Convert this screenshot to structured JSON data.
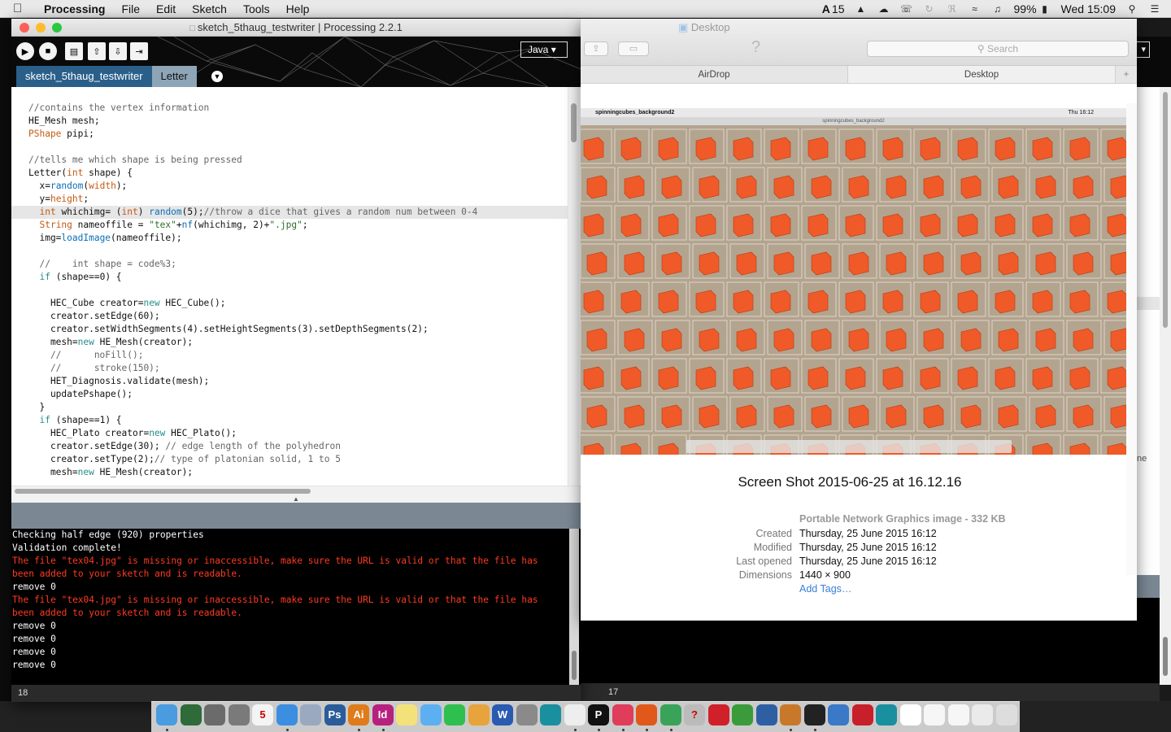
{
  "menubar": {
    "app": "Processing",
    "items": [
      "File",
      "Edit",
      "Sketch",
      "Tools",
      "Help"
    ],
    "status_badge": "15",
    "battery": "99%",
    "clock": "Wed 15:09"
  },
  "processing": {
    "window_title": "sketch_5thaug_testwriter | Processing 2.2.1",
    "mode": "Java",
    "tabs": [
      "sketch_5thaug_testwriter",
      "Letter"
    ],
    "active_tab": 0,
    "code_lines": [
      {
        "segments": [
          {
            "t": "//contains the vertex information",
            "c": "cm"
          }
        ]
      },
      {
        "segments": [
          {
            "t": "HE_Mesh mesh;",
            "c": ""
          }
        ]
      },
      {
        "segments": [
          {
            "t": "PShape",
            "c": "ty"
          },
          {
            "t": " pipi;",
            "c": ""
          }
        ]
      },
      {
        "segments": [
          {
            "t": "",
            "c": ""
          }
        ]
      },
      {
        "segments": [
          {
            "t": "//tells me which shape is being pressed",
            "c": "cm"
          }
        ]
      },
      {
        "segments": [
          {
            "t": "Letter(",
            "c": ""
          },
          {
            "t": "int",
            "c": "ty"
          },
          {
            "t": " shape) {",
            "c": ""
          }
        ]
      },
      {
        "segments": [
          {
            "t": "  x=",
            "c": ""
          },
          {
            "t": "random",
            "c": "fn"
          },
          {
            "t": "(",
            "c": ""
          },
          {
            "t": "width",
            "c": "ty"
          },
          {
            "t": ");",
            "c": ""
          }
        ]
      },
      {
        "segments": [
          {
            "t": "  y=",
            "c": ""
          },
          {
            "t": "height",
            "c": "ty"
          },
          {
            "t": ";",
            "c": ""
          }
        ]
      },
      {
        "segments": [
          {
            "t": "  ",
            "c": ""
          },
          {
            "t": "int",
            "c": "ty"
          },
          {
            "t": " whichimg= (",
            "c": ""
          },
          {
            "t": "int",
            "c": "ty"
          },
          {
            "t": ") ",
            "c": ""
          },
          {
            "t": "random",
            "c": "fn"
          },
          {
            "t": "(5);",
            "c": ""
          },
          {
            "t": "//throw a dice that gives a random num between 0-4",
            "c": "cm"
          }
        ],
        "highlight": true
      },
      {
        "segments": [
          {
            "t": "  ",
            "c": ""
          },
          {
            "t": "String",
            "c": "ty"
          },
          {
            "t": " nameoffile = ",
            "c": ""
          },
          {
            "t": "\"tex\"",
            "c": "str"
          },
          {
            "t": "+",
            "c": ""
          },
          {
            "t": "nf",
            "c": "fn"
          },
          {
            "t": "(whichimg, 2)+",
            "c": ""
          },
          {
            "t": "\".jpg\"",
            "c": "str"
          },
          {
            "t": ";",
            "c": ""
          }
        ]
      },
      {
        "segments": [
          {
            "t": "  img=",
            "c": ""
          },
          {
            "t": "loadImage",
            "c": "fn"
          },
          {
            "t": "(nameoffile);",
            "c": ""
          }
        ]
      },
      {
        "segments": [
          {
            "t": "",
            "c": ""
          }
        ]
      },
      {
        "segments": [
          {
            "t": "  //    int shape = code%3;",
            "c": "cm"
          }
        ]
      },
      {
        "segments": [
          {
            "t": "  ",
            "c": ""
          },
          {
            "t": "if",
            "c": "kw"
          },
          {
            "t": " (shape==0) {",
            "c": ""
          }
        ]
      },
      {
        "segments": [
          {
            "t": "",
            "c": ""
          }
        ]
      },
      {
        "segments": [
          {
            "t": "    HEC_Cube creator=",
            "c": ""
          },
          {
            "t": "new",
            "c": "kw"
          },
          {
            "t": " HEC_Cube();",
            "c": ""
          }
        ]
      },
      {
        "segments": [
          {
            "t": "    creator.setEdge(60);",
            "c": ""
          }
        ]
      },
      {
        "segments": [
          {
            "t": "    creator.setWidthSegments(4).setHeightSegments(3).setDepthSegments(2);",
            "c": ""
          }
        ]
      },
      {
        "segments": [
          {
            "t": "    mesh=",
            "c": ""
          },
          {
            "t": "new",
            "c": "kw"
          },
          {
            "t": " HE_Mesh(creator);",
            "c": ""
          }
        ]
      },
      {
        "segments": [
          {
            "t": "    //      noFill();",
            "c": "cm"
          }
        ]
      },
      {
        "segments": [
          {
            "t": "    //      stroke(150);",
            "c": "cm"
          }
        ]
      },
      {
        "segments": [
          {
            "t": "    HET_Diagnosis.validate(mesh);",
            "c": ""
          }
        ]
      },
      {
        "segments": [
          {
            "t": "    updatePshape();",
            "c": ""
          }
        ]
      },
      {
        "segments": [
          {
            "t": "  }",
            "c": ""
          }
        ]
      },
      {
        "segments": [
          {
            "t": "  ",
            "c": ""
          },
          {
            "t": "if",
            "c": "kw"
          },
          {
            "t": " (shape==1) {",
            "c": ""
          }
        ]
      },
      {
        "segments": [
          {
            "t": "    HEC_Plato creator=",
            "c": ""
          },
          {
            "t": "new",
            "c": "kw"
          },
          {
            "t": " HEC_Plato();",
            "c": ""
          }
        ]
      },
      {
        "segments": [
          {
            "t": "    creator.setEdge(30); ",
            "c": ""
          },
          {
            "t": "// edge length of the polyhedron",
            "c": "cm"
          }
        ]
      },
      {
        "segments": [
          {
            "t": "    creator.setType(2);",
            "c": ""
          },
          {
            "t": "// type of platonian solid, 1 to 5",
            "c": "cm"
          }
        ]
      },
      {
        "segments": [
          {
            "t": "    mesh=",
            "c": ""
          },
          {
            "t": "new",
            "c": "kw"
          },
          {
            "t": " HE_Mesh(creator);",
            "c": ""
          }
        ]
      }
    ],
    "console": [
      {
        "text": "Checking half edge (920) properties",
        "err": false
      },
      {
        "text": "Validation complete!",
        "err": false
      },
      {
        "text": "The file \"tex04.jpg\" is missing or inaccessible, make sure the URL is valid or that the file has",
        "err": true
      },
      {
        "text": "been added to your sketch and is readable.",
        "err": true
      },
      {
        "text": "remove 0",
        "err": false
      },
      {
        "text": "The file \"tex04.jpg\" is missing or inaccessible, make sure the URL is valid or that the file has",
        "err": true
      },
      {
        "text": "been added to your sketch and is readable.",
        "err": true
      },
      {
        "text": "remove 0",
        "err": false
      },
      {
        "text": "remove 0",
        "err": false
      },
      {
        "text": "remove 0",
        "err": false
      },
      {
        "text": "remove 0",
        "err": false
      }
    ],
    "line_number": "18",
    "second_window_line_number": "17"
  },
  "finder": {
    "title": "Desktop",
    "search_placeholder": "Search",
    "tabs": [
      "AirDrop",
      "Desktop"
    ],
    "preview_app_name": "spinningcubes_background2",
    "preview_window_title": "spinningcubes_background2",
    "preview_clock": "Thu 16:12",
    "file_name": "Screen Shot 2015-06-25 at 16.12.16",
    "kind": "Portable Network Graphics image - 332 KB",
    "info": [
      {
        "label": "Created",
        "value": "Thursday, 25 June 2015 16:12"
      },
      {
        "label": "Modified",
        "value": "Thursday, 25 June 2015 16:12"
      },
      {
        "label": "Last opened",
        "value": "Thursday, 25 June 2015 16:12"
      },
      {
        "label": "Dimensions",
        "value": "1440 × 900"
      }
    ],
    "add_tags": "Add Tags…"
  },
  "colors": {
    "tab_active": "#2a5f8a",
    "tab_inactive": "#8ea5b7",
    "console_error": "#ff3a20",
    "cube_orange": "#f05a28",
    "preview_bg": "#b3a48f"
  },
  "dock": {
    "icons": [
      "finder-icon",
      "dashboard-icon",
      "launchpad-icon",
      "system-preferences-icon",
      "calendar-icon",
      "safari-icon",
      "mail-icon",
      "photoshop-icon",
      "illustrator-icon",
      "indesign-icon",
      "notes-icon",
      "messages-icon",
      "facetime-icon",
      "photos-icon",
      "word-icon",
      "vmware-icon",
      "arduino-icon",
      "textedit-icon",
      "processing-icon",
      "itunes-icon",
      "firefox-icon",
      "chrome-icon",
      "help-icon",
      "mamp-icon",
      "fiji-icon",
      "virtualbox-icon",
      "sketch-icon",
      "terminal-icon",
      "xcode-icon",
      "acrobat-icon",
      "arduino-icon-2",
      "preview-doc-icon",
      "document-icon",
      "document-icon-2",
      "mail-doc-icon",
      "trash-icon"
    ],
    "calendar_day": "5"
  }
}
